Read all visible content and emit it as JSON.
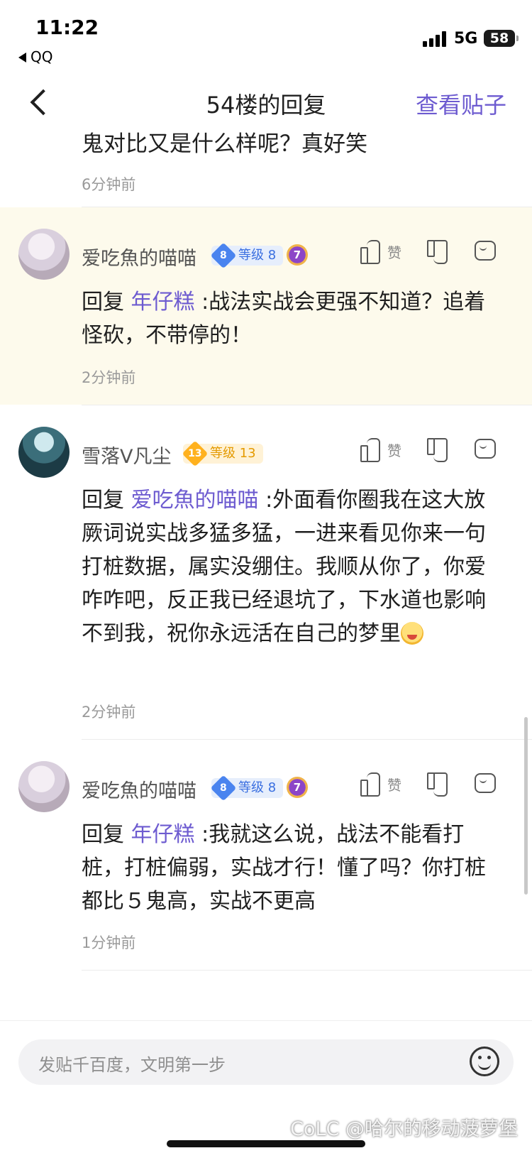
{
  "status_bar": {
    "time": "11:22",
    "back_app": "QQ",
    "network": "5G",
    "battery": "58"
  },
  "nav": {
    "title": "54楼的回复",
    "action": "查看贴子"
  },
  "partial_comment": {
    "text": "鬼对比又是什么样呢？真好笑",
    "time": "6分钟前"
  },
  "comments": [
    {
      "username": "爱吃魚的喵喵",
      "level_num": "8",
      "level_label": "等级 8",
      "medal": "7",
      "like_label": "赞",
      "reply_prefix": "回复 ",
      "mention": "年仔糕",
      "text": " :战法实战会更强不知道？追着怪砍，不带停的！",
      "time": "2分钟前",
      "highlighted": true
    },
    {
      "username": "雪落V凡尘",
      "level_num": "13",
      "level_label": "等级 13",
      "like_label": "赞",
      "reply_prefix": "回复 ",
      "mention": "爱吃魚的喵喵",
      "text": " :外面看你圈我在这大放厥词说实战多猛多猛，一进来看见你来一句打桩数据，属实没绷住。我顺从你了，你爱咋咋吧，反正我已经退坑了，下水道也影响不到我，祝你永远活在自己的梦里",
      "time": "2分钟前"
    },
    {
      "username": "爱吃魚的喵喵",
      "level_num": "8",
      "level_label": "等级 8",
      "medal": "7",
      "like_label": "赞",
      "reply_prefix": "回复 ",
      "mention": "年仔糕",
      "text": " :我就这么说，战法不能看打桩，打桩偏弱，实战才行！懂了吗？你打桩都比５鬼高，实战不更高",
      "time": "1分钟前"
    }
  ],
  "input": {
    "placeholder": "发贴千百度，文明第一步"
  },
  "watermark": "CoLC @哈尔的移动菠萝堡",
  "colors": {
    "accent": "#6d5bd0",
    "highlight_bg": "#fdfaec"
  }
}
